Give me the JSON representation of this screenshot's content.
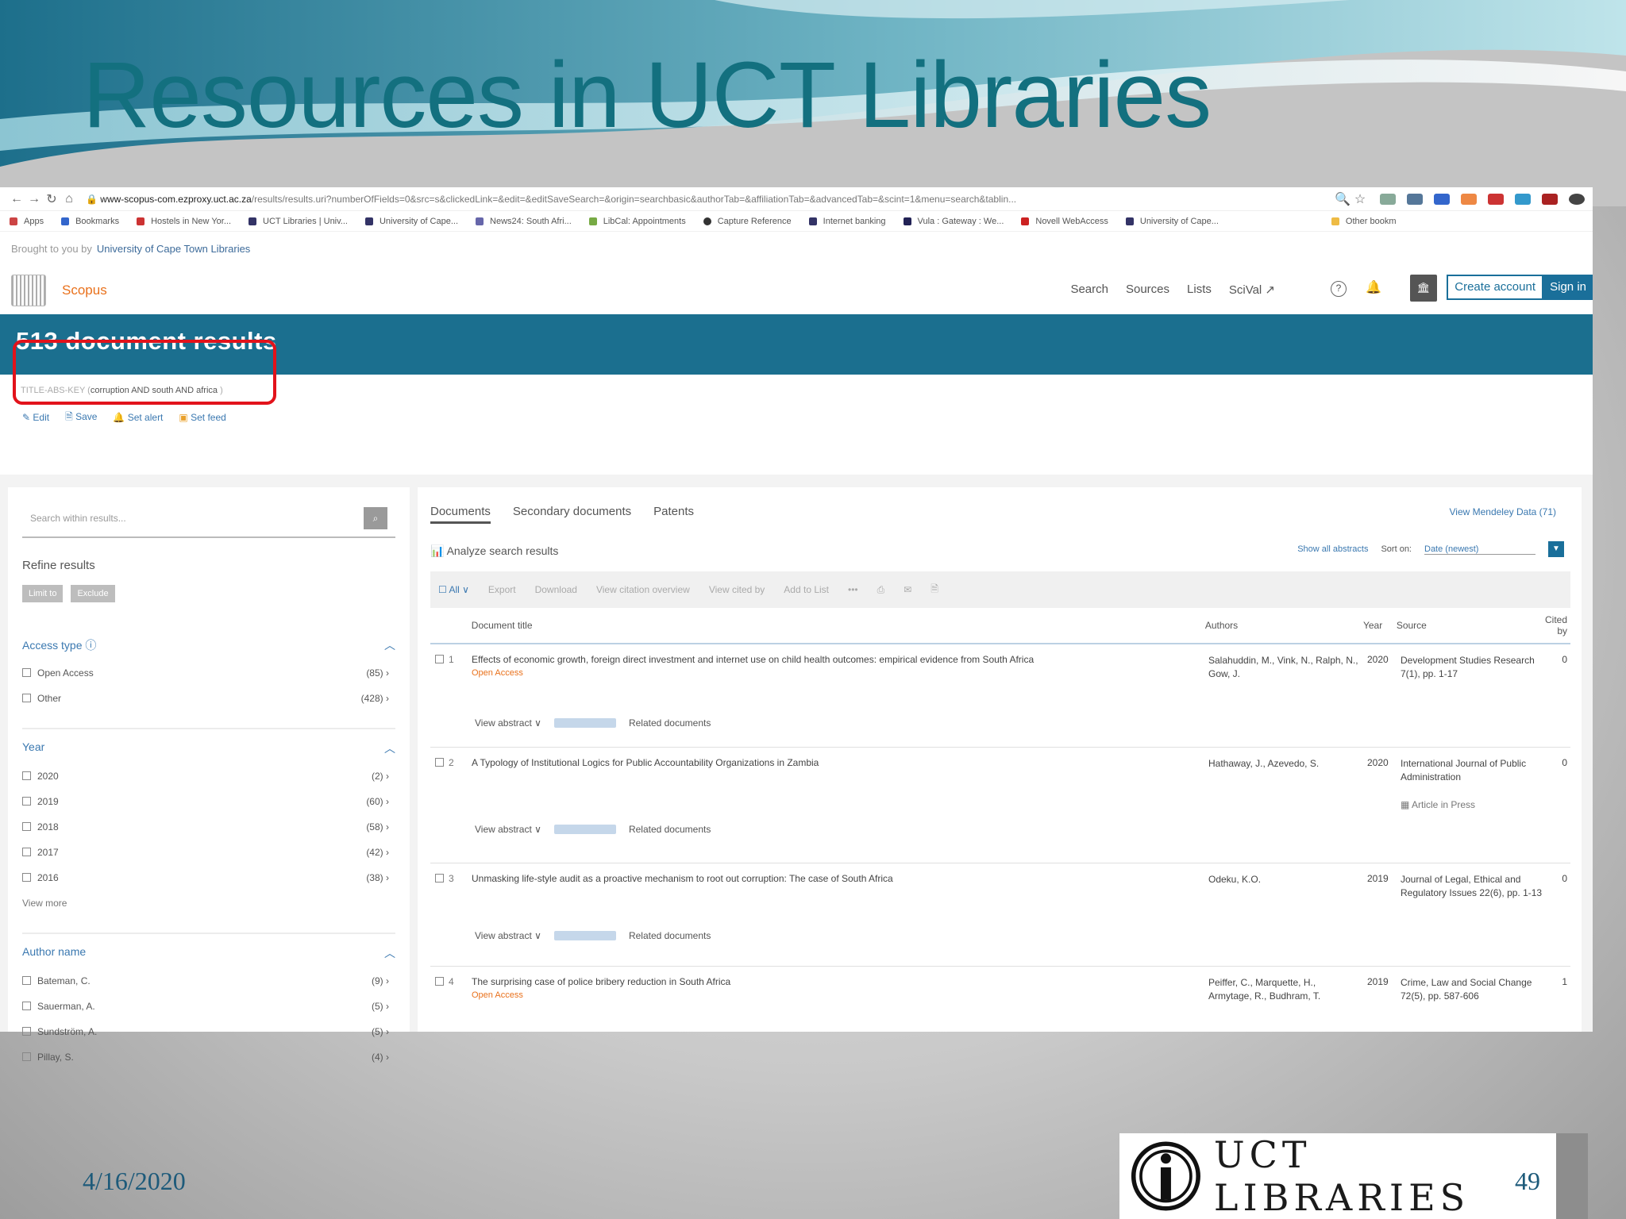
{
  "slide": {
    "title": "Resources in UCT Libraries",
    "date": "4/16/2020",
    "page_number": "49",
    "logo_text": "UCT LIBRARIES"
  },
  "browser": {
    "url_host": "www-scopus-com.ezproxy.uct.ac.za",
    "url_path": "/results/results.uri?numberOfFields=0&src=s&clickedLink=&edit=&editSaveSearch=&origin=searchbasic&authorTab=&affiliationTab=&advancedTab=&scint=1&menu=search&tablin...",
    "bookmarks": [
      "Apps",
      "Bookmarks",
      "Hostels in New Yor...",
      "UCT Libraries | Univ...",
      "University of Cape...",
      "News24: South Afri...",
      "LibCal: Appointments",
      "Capture Reference",
      "Internet banking",
      "Vula : Gateway : We...",
      "Novell WebAccess",
      "University of Cape...",
      "Other bookm"
    ]
  },
  "scopus": {
    "brought_label": "Brought to you by",
    "brought_link": "University of Cape Town Libraries",
    "brand": "Scopus",
    "nav": [
      "Search",
      "Sources",
      "Lists",
      "SciVal ↗"
    ],
    "create_account": "Create account",
    "sign_in": "Sign in",
    "results_count": "513 document results",
    "query_prefix": "TITLE-ABS-KEY (",
    "query_terms": "corruption AND south AND africa",
    "query_suffix": ")",
    "actions": [
      "Edit",
      "Save",
      "Set alert",
      "Set feed"
    ]
  },
  "sidebar": {
    "search_placeholder": "Search within results...",
    "refine_label": "Refine results",
    "limit_to": "Limit to",
    "exclude": "Exclude",
    "access_type": {
      "title": "Access type",
      "items": [
        {
          "label": "Open Access",
          "count": "(85)"
        },
        {
          "label": "Other",
          "count": "(428)"
        }
      ]
    },
    "year": {
      "title": "Year",
      "items": [
        {
          "label": "2020",
          "count": "(2)"
        },
        {
          "label": "2019",
          "count": "(60)"
        },
        {
          "label": "2018",
          "count": "(58)"
        },
        {
          "label": "2017",
          "count": "(42)"
        },
        {
          "label": "2016",
          "count": "(38)"
        }
      ],
      "view_more": "View more"
    },
    "author": {
      "title": "Author name",
      "items": [
        {
          "label": "Bateman, C.",
          "count": "(9)"
        },
        {
          "label": "Sauerman, A.",
          "count": "(5)"
        },
        {
          "label": "Sundström, A.",
          "count": "(5)"
        },
        {
          "label": "Pillay, S.",
          "count": "(4)"
        }
      ]
    }
  },
  "main": {
    "tabs": [
      "Documents",
      "Secondary documents",
      "Patents"
    ],
    "mendeley": "View Mendeley Data (71)",
    "analyze": "Analyze search results",
    "show_abstracts": "Show all abstracts",
    "sort_label": "Sort on:",
    "sort_value": "Date (newest)",
    "toolbar": [
      "All",
      "Export",
      "Download",
      "View citation overview",
      "View cited by",
      "Add to List",
      "•••"
    ],
    "columns": [
      "Document title",
      "Authors",
      "Year",
      "Source",
      "Cited by"
    ],
    "view_abstract": "View abstract ∨",
    "related": "Related documents",
    "rows": [
      {
        "n": "1",
        "title": "Effects of economic growth, foreign direct investment and internet use on child health outcomes: empirical evidence from South Africa",
        "oa": "Open Access",
        "authors": "Salahuddin, M., Vink, N., Ralph, N., Gow, J.",
        "year": "2020",
        "source": "Development Studies Research 7(1), pp. 1-17",
        "cited": "0"
      },
      {
        "n": "2",
        "title": "A Typology of Institutional Logics for Public Accountability Organizations in Zambia",
        "oa": "",
        "authors": "Hathaway, J., Azevedo, S.",
        "year": "2020",
        "source": "International Journal of Public Administration",
        "press": "Article in Press",
        "cited": "0"
      },
      {
        "n": "3",
        "title": "Unmasking life-style audit as a proactive mechanism to root out corruption: The case of South Africa",
        "oa": "",
        "authors": "Odeku, K.O.",
        "year": "2019",
        "source": "Journal of Legal, Ethical and Regulatory Issues 22(6), pp. 1-13",
        "cited": "0"
      },
      {
        "n": "4",
        "title": "The surprising case of police bribery reduction in South Africa",
        "oa": "Open Access",
        "authors": "Peiffer, C., Marquette, H., Armytage, R., Budhram, T.",
        "year": "2019",
        "source": "Crime, Law and Social Change 72(5), pp. 587-606",
        "cited": "1"
      }
    ]
  }
}
